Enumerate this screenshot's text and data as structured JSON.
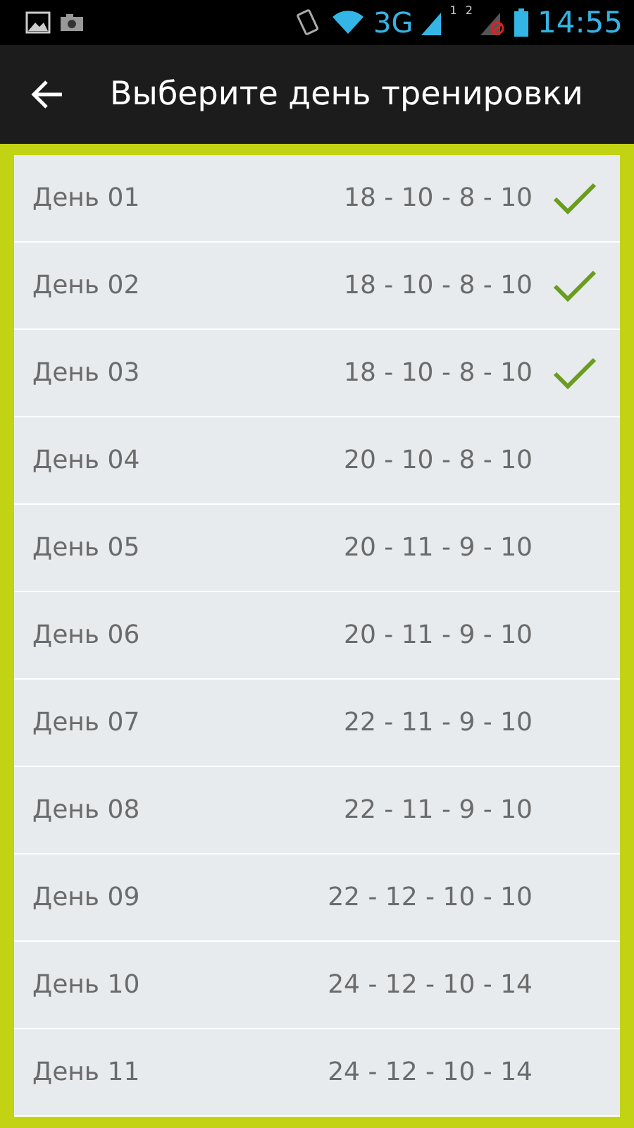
{
  "status_bar": {
    "network": "3G",
    "sim_1": "1",
    "sim_2": "2",
    "time": "14:55"
  },
  "toolbar": {
    "title": "Выберите день тренировки"
  },
  "days": [
    {
      "label": "День 01",
      "reps": "18 - 10 - 8 - 10",
      "checked": true
    },
    {
      "label": "День 02",
      "reps": "18 - 10 - 8 - 10",
      "checked": true
    },
    {
      "label": "День 03",
      "reps": "18 - 10 - 8 - 10",
      "checked": true
    },
    {
      "label": "День 04",
      "reps": "20 - 10 - 8 - 10",
      "checked": false
    },
    {
      "label": "День 05",
      "reps": "20 - 11 - 9 - 10",
      "checked": false
    },
    {
      "label": "День 06",
      "reps": "20 - 11 - 9 - 10",
      "checked": false
    },
    {
      "label": "День 07",
      "reps": "22 - 11 - 9 - 10",
      "checked": false
    },
    {
      "label": "День 08",
      "reps": "22 - 11 - 9 - 10",
      "checked": false
    },
    {
      "label": "День 09",
      "reps": "22 - 12 - 10 - 10",
      "checked": false
    },
    {
      "label": "День 10",
      "reps": "24 - 12 - 10 - 14",
      "checked": false
    },
    {
      "label": "День 11",
      "reps": "24 - 12 - 10 - 14",
      "checked": false
    }
  ]
}
